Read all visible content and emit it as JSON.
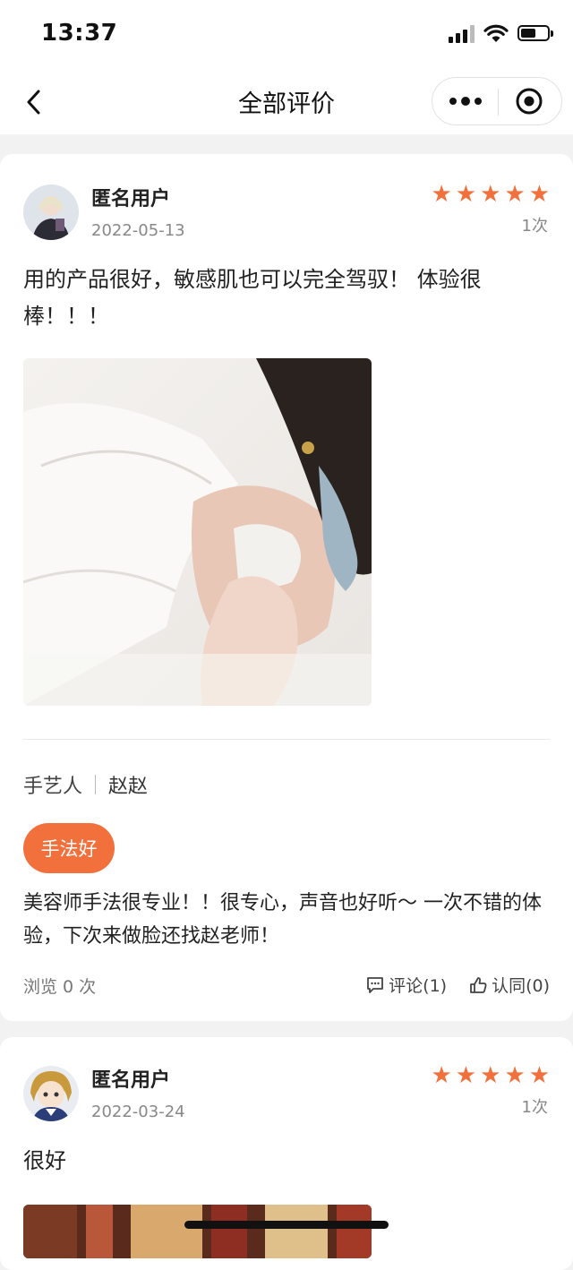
{
  "status_bar": {
    "time": "13:37"
  },
  "nav": {
    "title": "全部评价"
  },
  "reviews": [
    {
      "user": "匿名用户",
      "date": "2022-05-13",
      "rating": 5,
      "times": "1次",
      "content": "用的产品很好，敏感肌也可以完全驾驭！ 体验很棒！！！",
      "artisan_label": "手艺人",
      "artisan_name": "赵赵",
      "tag": "手法好",
      "artisan_comment": "美容师手法很专业！！很专心，声音也好听～ 一次不错的体验，下次来做脸还找赵老师！",
      "views": "浏览 0 次",
      "comments": "评论(1)",
      "likes": "认同(0)"
    },
    {
      "user": "匿名用户",
      "date": "2022-03-24",
      "rating": 5,
      "times": "1次",
      "content": "很好"
    }
  ],
  "icons": {
    "back": "chevron-left-icon",
    "more": "more-dots-icon",
    "close": "target-circle-icon",
    "comment": "comment-icon",
    "like": "thumbs-up-icon",
    "star": "star-icon"
  },
  "colors": {
    "accent": "#f2703c"
  }
}
